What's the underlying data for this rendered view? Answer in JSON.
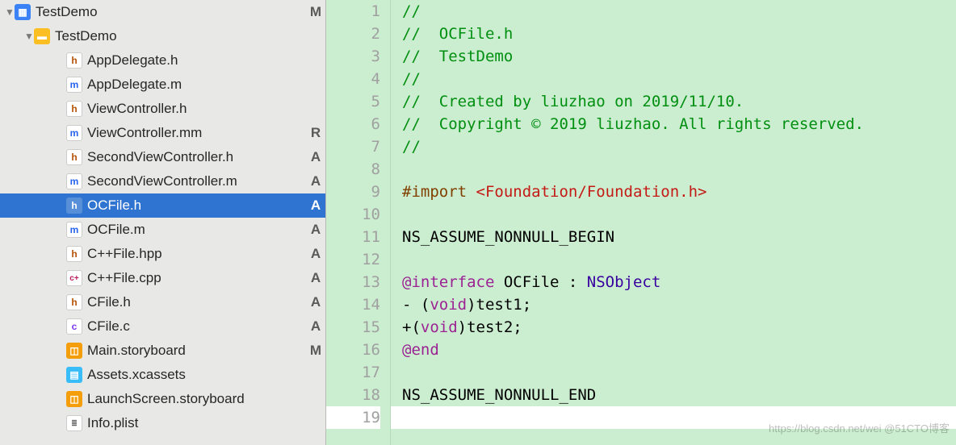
{
  "sidebar": {
    "items": [
      {
        "name": "TestDemo",
        "icon": "proj",
        "depth": 0,
        "disclosure": "▼",
        "status": "M"
      },
      {
        "name": "TestDemo",
        "icon": "folder",
        "depth": 1,
        "disclosure": "▼",
        "status": ""
      },
      {
        "name": "AppDelegate.h",
        "icon": "h",
        "depth": 2,
        "disclosure": "",
        "status": ""
      },
      {
        "name": "AppDelegate.m",
        "icon": "m",
        "depth": 2,
        "disclosure": "",
        "status": ""
      },
      {
        "name": "ViewController.h",
        "icon": "h",
        "depth": 2,
        "disclosure": "",
        "status": ""
      },
      {
        "name": "ViewController.mm",
        "icon": "m",
        "depth": 2,
        "disclosure": "",
        "status": "R"
      },
      {
        "name": "SecondViewController.h",
        "icon": "h",
        "depth": 2,
        "disclosure": "",
        "status": "A"
      },
      {
        "name": "SecondViewController.m",
        "icon": "m",
        "depth": 2,
        "disclosure": "",
        "status": "A"
      },
      {
        "name": "OCFile.h",
        "icon": "h",
        "depth": 2,
        "disclosure": "",
        "status": "A",
        "selected": true
      },
      {
        "name": "OCFile.m",
        "icon": "m",
        "depth": 2,
        "disclosure": "",
        "status": "A"
      },
      {
        "name": "C++File.hpp",
        "icon": "h",
        "depth": 2,
        "disclosure": "",
        "status": "A"
      },
      {
        "name": "C++File.cpp",
        "icon": "cpp",
        "depth": 2,
        "disclosure": "",
        "status": "A"
      },
      {
        "name": "CFile.h",
        "icon": "h",
        "depth": 2,
        "disclosure": "",
        "status": "A"
      },
      {
        "name": "CFile.c",
        "icon": "c",
        "depth": 2,
        "disclosure": "",
        "status": "A"
      },
      {
        "name": "Main.storyboard",
        "icon": "sb",
        "depth": 2,
        "disclosure": "",
        "status": "M"
      },
      {
        "name": "Assets.xcassets",
        "icon": "xc",
        "depth": 2,
        "disclosure": "",
        "status": ""
      },
      {
        "name": "LaunchScreen.storyboard",
        "icon": "sb",
        "depth": 2,
        "disclosure": "",
        "status": ""
      },
      {
        "name": "Info.plist",
        "icon": "pl",
        "depth": 2,
        "disclosure": "",
        "status": ""
      }
    ]
  },
  "icon_glyph": {
    "proj": "▦",
    "folder": "▬",
    "h": "h",
    "m": "m",
    "c": "c",
    "cpp": "c+",
    "sb": "◫",
    "xc": "▤",
    "pl": "≣"
  },
  "code": {
    "lines": [
      {
        "n": 1,
        "tokens": [
          {
            "t": "//",
            "c": "comment"
          }
        ]
      },
      {
        "n": 2,
        "tokens": [
          {
            "t": "//  OCFile.h",
            "c": "comment"
          }
        ]
      },
      {
        "n": 3,
        "tokens": [
          {
            "t": "//  TestDemo",
            "c": "comment"
          }
        ]
      },
      {
        "n": 4,
        "tokens": [
          {
            "t": "//",
            "c": "comment"
          }
        ]
      },
      {
        "n": 5,
        "tokens": [
          {
            "t": "//  Created by liuzhao on 2019/11/10.",
            "c": "comment"
          }
        ]
      },
      {
        "n": 6,
        "tokens": [
          {
            "t": "//  Copyright © 2019 liuzhao. All rights reserved.",
            "c": "comment"
          }
        ]
      },
      {
        "n": 7,
        "tokens": [
          {
            "t": "//",
            "c": "comment"
          }
        ]
      },
      {
        "n": 8,
        "tokens": []
      },
      {
        "n": 9,
        "tokens": [
          {
            "t": "#import ",
            "c": "pp"
          },
          {
            "t": "<Foundation/Foundation.h>",
            "c": "str"
          }
        ]
      },
      {
        "n": 10,
        "tokens": []
      },
      {
        "n": 11,
        "tokens": [
          {
            "t": "NS_ASSUME_NONNULL_BEGIN",
            "c": "black"
          }
        ]
      },
      {
        "n": 12,
        "tokens": []
      },
      {
        "n": 13,
        "tokens": [
          {
            "t": "@interface",
            "c": "kw"
          },
          {
            "t": " OCFile : ",
            "c": "black"
          },
          {
            "t": "NSObject",
            "c": "type"
          }
        ]
      },
      {
        "n": 14,
        "tokens": [
          {
            "t": "- (",
            "c": "black"
          },
          {
            "t": "void",
            "c": "kw2"
          },
          {
            "t": ")test1;",
            "c": "black"
          }
        ]
      },
      {
        "n": 15,
        "tokens": [
          {
            "t": "+(",
            "c": "black"
          },
          {
            "t": "void",
            "c": "kw2"
          },
          {
            "t": ")test2;",
            "c": "black"
          }
        ]
      },
      {
        "n": 16,
        "tokens": [
          {
            "t": "@end",
            "c": "kw"
          }
        ]
      },
      {
        "n": 17,
        "tokens": []
      },
      {
        "n": 18,
        "tokens": [
          {
            "t": "NS_ASSUME_NONNULL_END",
            "c": "black"
          }
        ]
      },
      {
        "n": 19,
        "tokens": [],
        "blank": true
      }
    ]
  },
  "watermark": "https://blog.csdn.net/wei  @51CTO博客"
}
